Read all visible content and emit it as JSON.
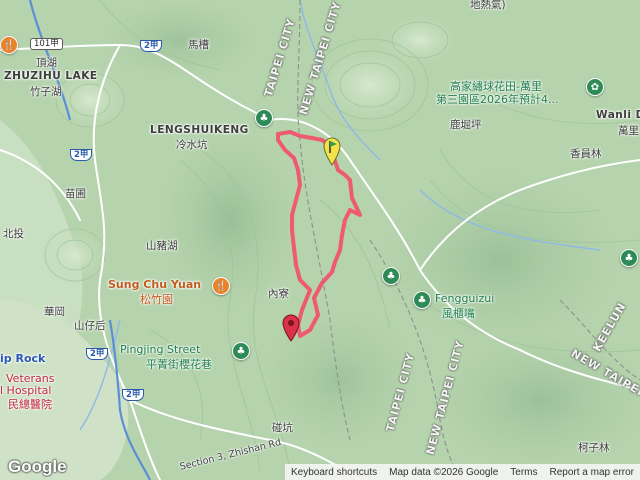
{
  "map": {
    "colors": {
      "terrain": "#b9d6b0",
      "trail": "#ef5a70",
      "road": "#ffffff",
      "highway": "#5a8fd6",
      "river": "#8fb8e8"
    },
    "place_labels": {
      "zhuzihu_lake": "ZHUZIHU LAKE",
      "zhuzihu_zh": "竹子湖",
      "dinghu": "頂湖",
      "macao": "馬槽",
      "lengshuikeng": "LENGSHUIKENG",
      "lengshuikeng_zh": "冷水坑",
      "lujuepin": "鹿堀坪",
      "xiangyuanlin": "香員林",
      "wanli": "Wanli D",
      "wanli_zh": "萬里",
      "dirrehqi": "地熱氣)",
      "miaopu": "苗圃",
      "beitou": "北投",
      "shanzhuhu": "山豬湖",
      "neiliao": "內寮",
      "huagang": "華岡",
      "shanzihou": "山仔后",
      "ip_rock": "ip Rock",
      "kezilin": "柯子林",
      "pingkeng": "碰坑",
      "veterans_1": "Veterans",
      "veterans_2": "l Hospital",
      "veterans_zh": "民總醫院",
      "road_zhishan": "Section 3, Zhishan Rd"
    },
    "poi_labels": {
      "sung_chu_yuan": "Sung Chu Yuan",
      "sung_chu_yuan_zh": "松竹園",
      "pingjing_street": "Pingjing Street",
      "pingjing_street_zh": "平菁街櫻花巷",
      "fengguizui": "Fengguizui",
      "fengguizui_zh": "風櫃嘴",
      "flower_farm_1": "高家繡球花田-萬里",
      "flower_farm_2": "第三園區2026年預計4..."
    },
    "boundary_labels": {
      "taipei_city_top": "TAIPEI CITY",
      "new_taipei_city_top": "NEW TAIPEI CITY",
      "taipei_city_bottom": "TAIPEI CITY",
      "new_taipei_city_bottom": "NEW TAIPEI CITY",
      "keelung": "KEELUN",
      "new_taipei_city_right": "NEW TAIPEI CITY"
    },
    "road_shields": {
      "r101a": "101甲",
      "r2a_top": "2甲",
      "r2a_left": "2甲",
      "r2a_bottom": "2甲",
      "r2": "2甲"
    },
    "icons": {
      "trail_start": "green-flag-marker",
      "trail_end": "red-pin-marker",
      "park": "park-icon",
      "restaurant": "fork-knife-icon",
      "flower": "flower-icon"
    },
    "attribution": {
      "logo": "Google",
      "shortcuts": "Keyboard shortcuts",
      "data": "Map data ©2026 Google",
      "terms": "Terms",
      "report": "Report a map error"
    }
  }
}
